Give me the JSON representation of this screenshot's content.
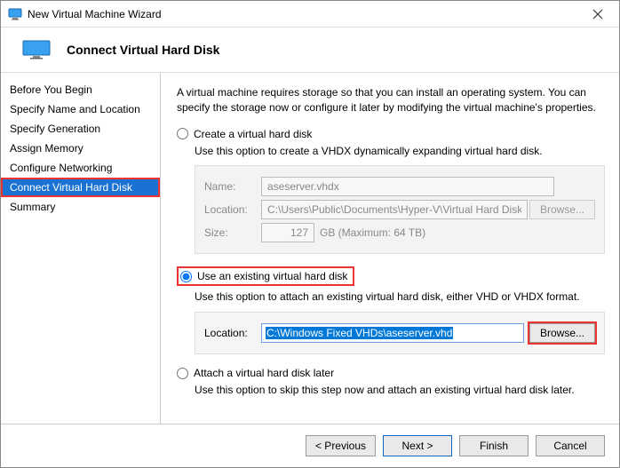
{
  "window": {
    "title": "New Virtual Machine Wizard"
  },
  "header": {
    "title": "Connect Virtual Hard Disk"
  },
  "sidebar": {
    "items": [
      {
        "label": "Before You Begin"
      },
      {
        "label": "Specify Name and Location"
      },
      {
        "label": "Specify Generation"
      },
      {
        "label": "Assign Memory"
      },
      {
        "label": "Configure Networking"
      },
      {
        "label": "Connect Virtual Hard Disk",
        "active": true
      },
      {
        "label": "Summary"
      }
    ]
  },
  "content": {
    "intro": "A virtual machine requires storage so that you can install an operating system. You can specify the storage now or configure it later by modifying the virtual machine's properties.",
    "opt_create": {
      "label": "Create a virtual hard disk",
      "desc": "Use this option to create a VHDX dynamically expanding virtual hard disk.",
      "name_label": "Name:",
      "name_value": "aseserver.vhdx",
      "loc_label": "Location:",
      "loc_value": "C:\\Users\\Public\\Documents\\Hyper-V\\Virtual Hard Disks\\",
      "browse_label": "Browse...",
      "size_label": "Size:",
      "size_value": "127",
      "size_unit": "GB (Maximum: 64 TB)"
    },
    "opt_existing": {
      "label": "Use an existing virtual hard disk",
      "desc": "Use this option to attach an existing virtual hard disk, either VHD or VHDX format.",
      "loc_label": "Location:",
      "loc_value": "C:\\Windows Fixed VHDs\\aseserver.vhd",
      "browse_label": "Browse..."
    },
    "opt_later": {
      "label": "Attach a virtual hard disk later",
      "desc": "Use this option to skip this step now and attach an existing virtual hard disk later."
    }
  },
  "footer": {
    "previous": "< Previous",
    "next": "Next >",
    "finish": "Finish",
    "cancel": "Cancel"
  }
}
